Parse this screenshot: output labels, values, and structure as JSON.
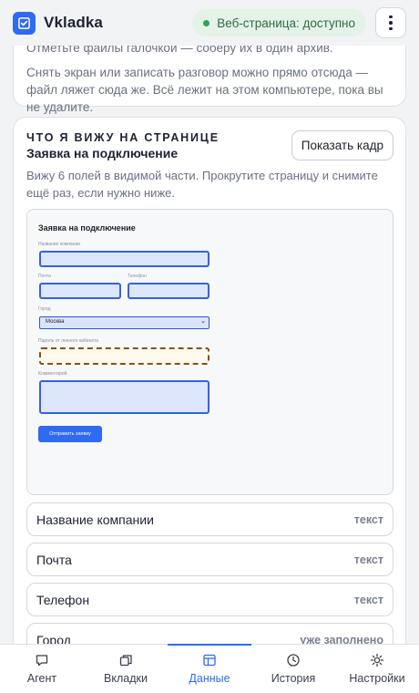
{
  "app": {
    "title": "Vkladka",
    "status": "Веб-страница: доступно"
  },
  "intro": {
    "line1": "Отметьте файлы галочкой — соберу их в один архив.",
    "line2": "Снять экран или записать разговор можно прямо отсюда — файл ляжет сюда же. Всё лежит на этом компьютере, пока вы не удалите."
  },
  "page_card": {
    "kicker": "ЧТО Я ВИЖУ НА СТРАНИЦЕ",
    "title": "Заявка на подключение",
    "show_button": "Показать кадр",
    "hint": "Вижу 6 полей в видимой части. Прокрутите страницу и снимите ещё раз, если нужно ниже."
  },
  "preview": {
    "title": "Заявка на подключение",
    "company_label": "Название компании",
    "email_label": "Почта",
    "phone_label": "Телефон",
    "city_label": "Город",
    "city_value": "Москва",
    "password_label": "Пароль от личного кабинета",
    "comment_label": "Комментарий",
    "submit_label": "Отправить заявку"
  },
  "fields": [
    {
      "name": "Название компании",
      "type": "текст"
    },
    {
      "name": "Почта",
      "type": "текст"
    },
    {
      "name": "Телефон",
      "type": "текст"
    },
    {
      "name": "Город",
      "type": "уже заполнено"
    }
  ],
  "nav": [
    {
      "label": "Агент",
      "icon": "chat-icon"
    },
    {
      "label": "Вкладки",
      "icon": "tabs-icon"
    },
    {
      "label": "Данные",
      "icon": "data-icon"
    },
    {
      "label": "История",
      "icon": "clock-icon"
    },
    {
      "label": "Настройки",
      "icon": "sun-gear-icon"
    }
  ],
  "colors": {
    "accent": "#2f6bf0",
    "status_bg": "#e4f2e8",
    "status_dot": "#27a55b",
    "warn_border": "#8a5012"
  }
}
